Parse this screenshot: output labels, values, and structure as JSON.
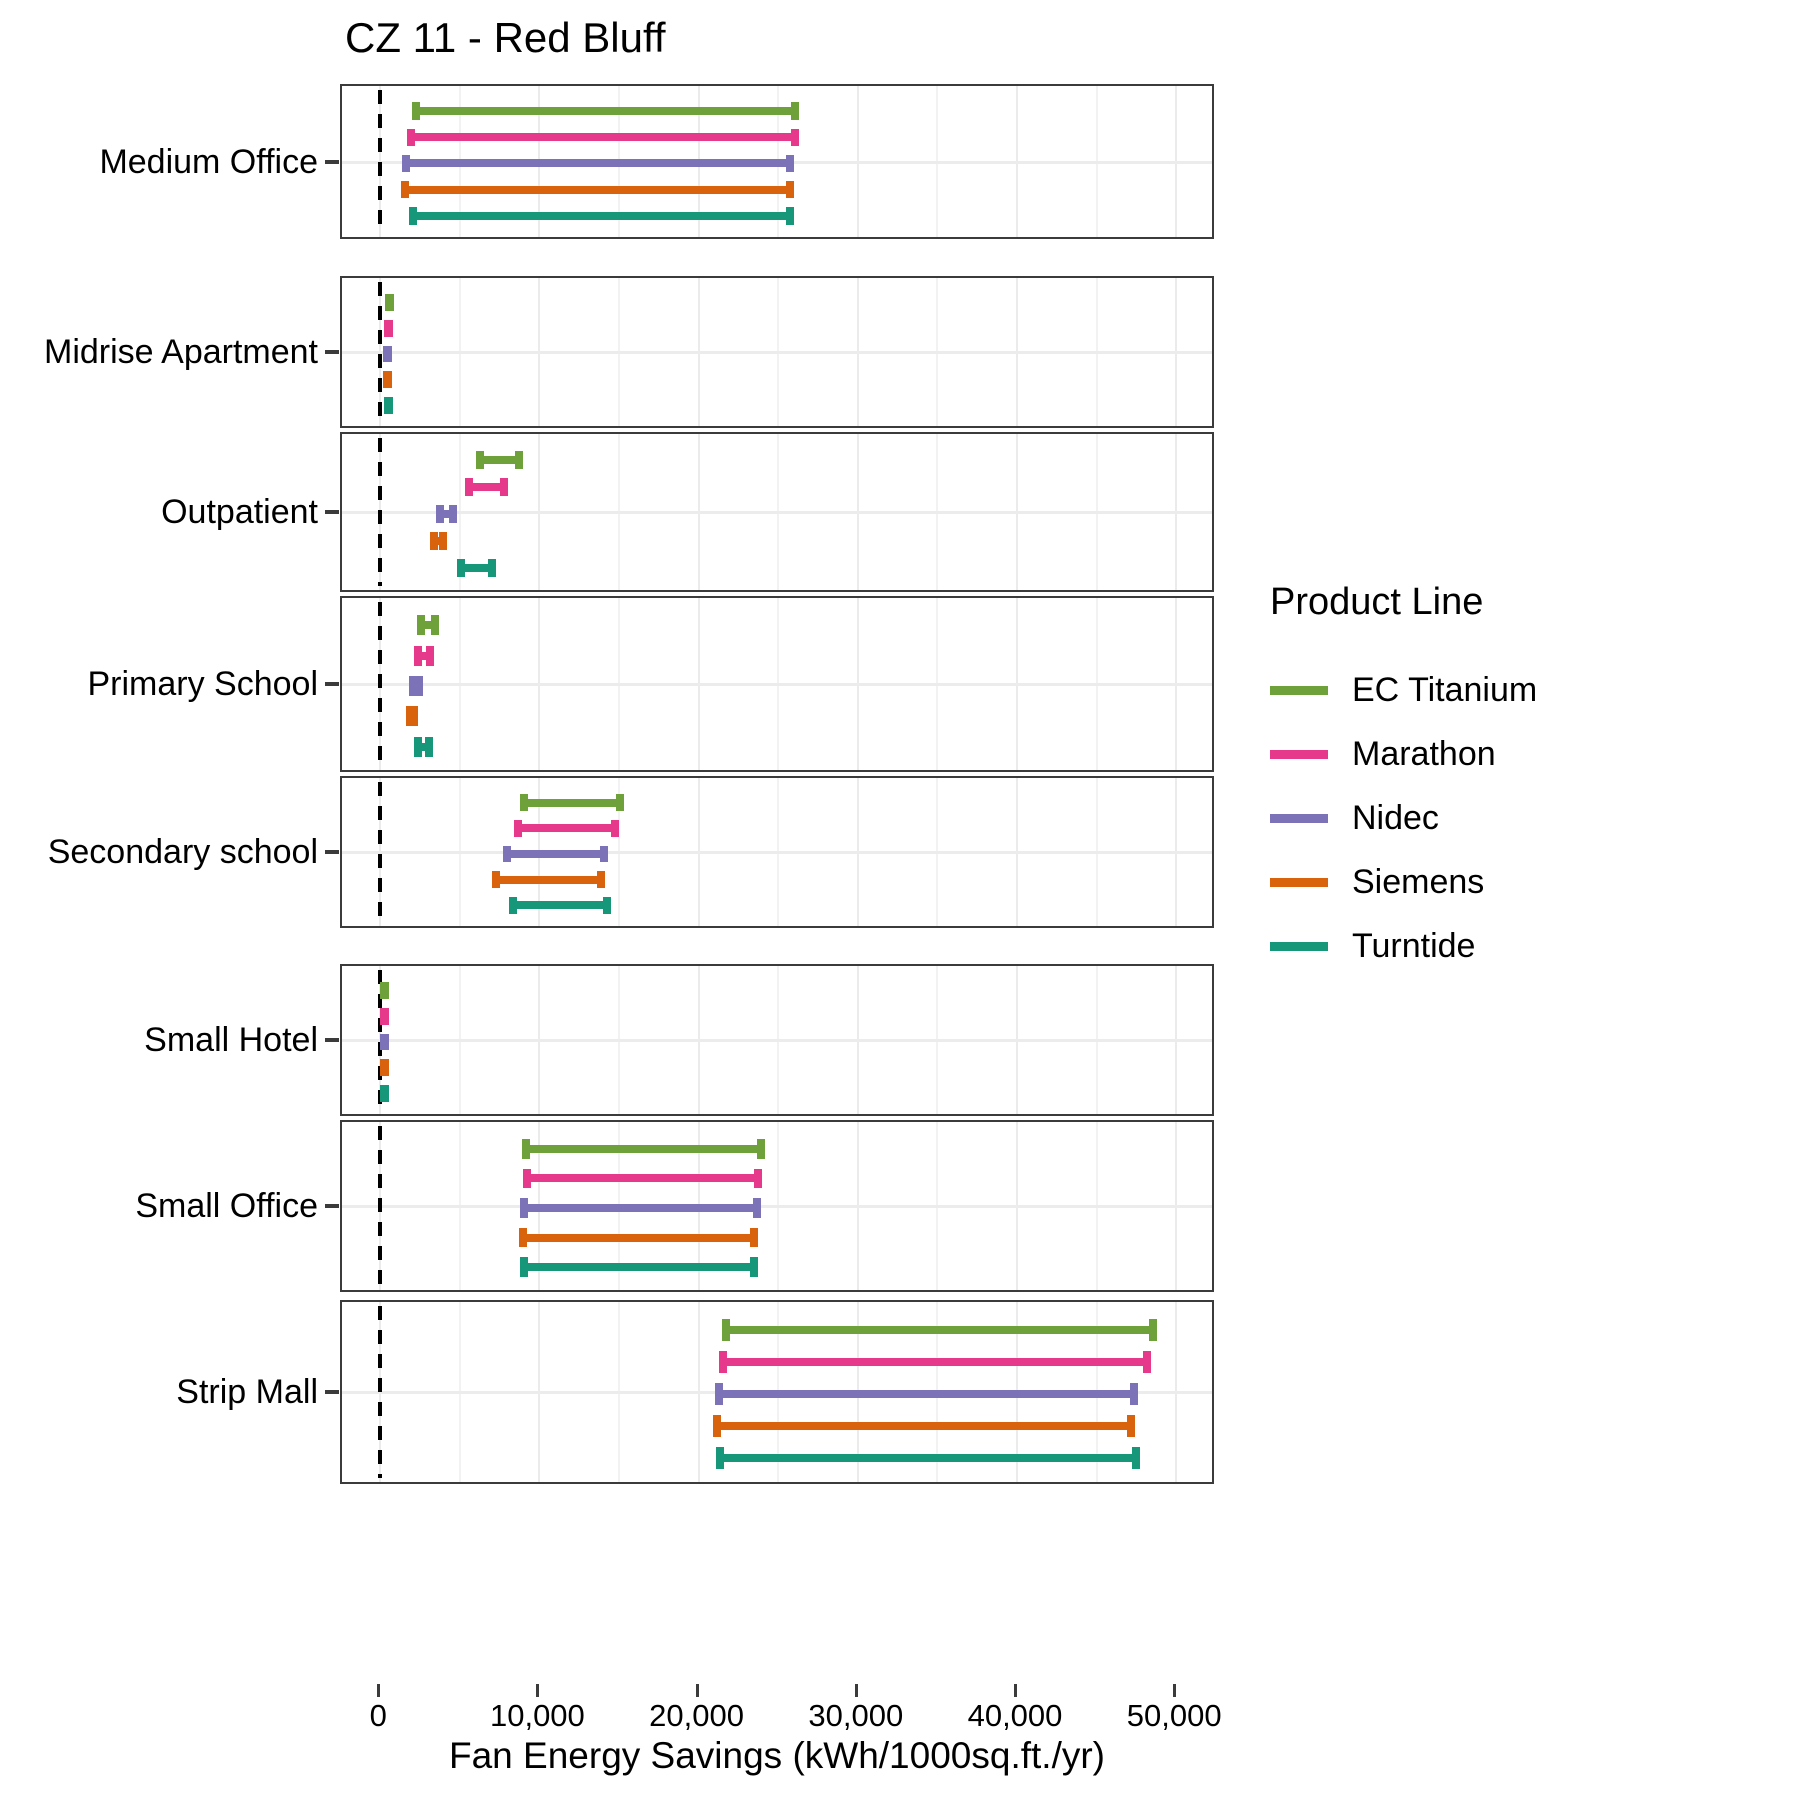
{
  "chart_data": {
    "type": "bar",
    "title": "CZ 11 - Red Bluff",
    "xlabel": "Fan Energy Savings (kWh/1000sq.ft./yr)",
    "ylabel": "",
    "subtitle": "",
    "grid": true,
    "legend_position": "right",
    "legend_title": "Product Line",
    "xlim": [
      -2400,
      52500
    ],
    "xticks": [
      0,
      10000,
      20000,
      30000,
      40000,
      50000
    ],
    "xticklabels": [
      "0",
      "10,000",
      "20,000",
      "30,000",
      "40,000",
      "50,000"
    ],
    "reference_line": {
      "value": 0,
      "style": "dashed",
      "color": "#000000"
    },
    "series": [
      {
        "name": "EC Titanium",
        "color": "#6FA13A"
      },
      {
        "name": "Marathon",
        "color": "#E6398C"
      },
      {
        "name": "Nidec",
        "color": "#7B72B8"
      },
      {
        "name": "Siemens",
        "color": "#D9630C"
      },
      {
        "name": "Turntide",
        "color": "#17977A"
      }
    ],
    "categories": [
      "Medium Office",
      "Midrise Apartment",
      "Outpatient",
      "Primary School",
      "Secondary school",
      "Small Hotel",
      "Small Office",
      "Strip Mall"
    ],
    "panels": [
      {
        "category": "Medium Office",
        "intervals": [
          {
            "series": "EC Titanium",
            "low": 2000,
            "high": 26300
          },
          {
            "series": "Marathon",
            "low": 1700,
            "high": 26300
          },
          {
            "series": "Nidec",
            "low": 1400,
            "high": 26000
          },
          {
            "series": "Siemens",
            "low": 1300,
            "high": 26000
          },
          {
            "series": "Turntide",
            "low": 1800,
            "high": 26000
          }
        ]
      },
      {
        "category": "Midrise Apartment",
        "intervals": [
          {
            "series": "EC Titanium",
            "low": 300,
            "high": 800
          },
          {
            "series": "Marathon",
            "low": 250,
            "high": 750
          },
          {
            "series": "Nidec",
            "low": 200,
            "high": 650
          },
          {
            "series": "Siemens",
            "low": 150,
            "high": 600
          },
          {
            "series": "Turntide",
            "low": 250,
            "high": 700
          }
        ]
      },
      {
        "category": "Outpatient",
        "intervals": [
          {
            "series": "EC Titanium",
            "low": 6000,
            "high": 9000
          },
          {
            "series": "Marathon",
            "low": 5300,
            "high": 8000
          },
          {
            "series": "Nidec",
            "low": 3500,
            "high": 4800
          },
          {
            "series": "Siemens",
            "low": 3100,
            "high": 4200
          },
          {
            "series": "Turntide",
            "low": 4800,
            "high": 7300
          }
        ]
      },
      {
        "category": "Primary School",
        "intervals": [
          {
            "series": "EC Titanium",
            "low": 2300,
            "high": 3700
          },
          {
            "series": "Marathon",
            "low": 2100,
            "high": 3400
          },
          {
            "series": "Nidec",
            "low": 1800,
            "high": 2700
          },
          {
            "series": "Siemens",
            "low": 1600,
            "high": 2400
          },
          {
            "series": "Turntide",
            "low": 2100,
            "high": 3300
          }
        ]
      },
      {
        "category": "Secondary school",
        "intervals": [
          {
            "series": "EC Titanium",
            "low": 8800,
            "high": 15300
          },
          {
            "series": "Marathon",
            "low": 8400,
            "high": 15000
          },
          {
            "series": "Nidec",
            "low": 7700,
            "high": 14300
          },
          {
            "series": "Siemens",
            "low": 7000,
            "high": 14100
          },
          {
            "series": "Turntide",
            "low": 8100,
            "high": 14500
          }
        ]
      },
      {
        "category": "Small Hotel",
        "intervals": [
          {
            "series": "EC Titanium",
            "low": 0,
            "high": 350
          },
          {
            "series": "Marathon",
            "low": 0,
            "high": 300
          },
          {
            "series": "Nidec",
            "low": 0,
            "high": 280
          },
          {
            "series": "Siemens",
            "low": 0,
            "high": 250
          },
          {
            "series": "Turntide",
            "low": 0,
            "high": 300
          }
        ]
      },
      {
        "category": "Small Office",
        "intervals": [
          {
            "series": "EC Titanium",
            "low": 8900,
            "high": 24200
          },
          {
            "series": "Marathon",
            "low": 9000,
            "high": 24000
          },
          {
            "series": "Nidec",
            "low": 8800,
            "high": 23900
          },
          {
            "series": "Siemens",
            "low": 8700,
            "high": 23700
          },
          {
            "series": "Turntide",
            "low": 8800,
            "high": 23700
          }
        ]
      },
      {
        "category": "Strip Mall",
        "intervals": [
          {
            "series": "EC Titanium",
            "low": 21500,
            "high": 48800
          },
          {
            "series": "Marathon",
            "low": 21300,
            "high": 48400
          },
          {
            "series": "Nidec",
            "low": 21000,
            "high": 47600
          },
          {
            "series": "Siemens",
            "low": 20900,
            "high": 47400
          },
          {
            "series": "Turntide",
            "low": 21100,
            "high": 47700
          }
        ]
      }
    ]
  },
  "legend": {
    "title": "Product Line",
    "items": [
      {
        "label": "EC Titanium",
        "color": "#6FA13A"
      },
      {
        "label": "Marathon",
        "color": "#E6398C"
      },
      {
        "label": "Nidec",
        "color": "#7B72B8"
      },
      {
        "label": "Siemens",
        "color": "#D9630C"
      },
      {
        "label": "Turntide",
        "color": "#17977A"
      }
    ]
  },
  "axes": {
    "x_title": "Fan Energy Savings (kWh/1000sq.ft./yr)",
    "x_ticklabels": [
      "0",
      "10,000",
      "20,000",
      "30,000",
      "40,000",
      "50,000"
    ],
    "y_ticklabels": [
      "Medium Office",
      "Midrise Apartment",
      "Outpatient",
      "Primary School",
      "Secondary school",
      "Small Hotel",
      "Small Office",
      "Strip Mall"
    ]
  },
  "title": "CZ 11 - Red Bluff"
}
